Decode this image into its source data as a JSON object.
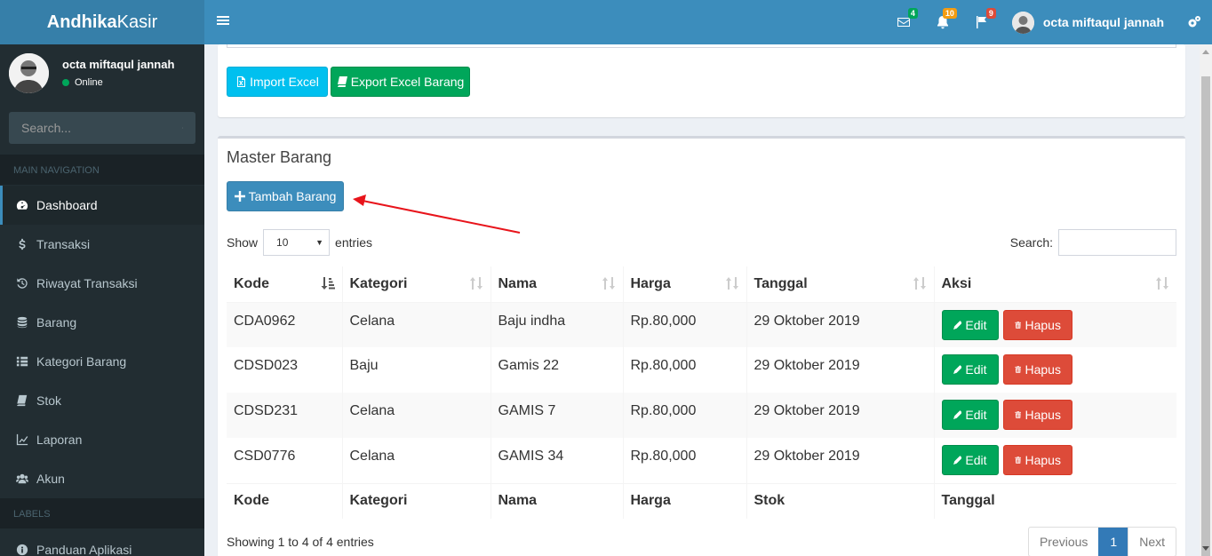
{
  "app": {
    "logo_bold": "Andhika",
    "logo_light": "Kasir"
  },
  "header": {
    "badges": {
      "mail": "4",
      "notifications": "10",
      "flags": "9"
    },
    "user_name": "octa miftaqul jannah"
  },
  "sidebar": {
    "user": {
      "name": "octa miftaqul jannah",
      "status": "Online"
    },
    "search_placeholder": "Search...",
    "nav_header": "MAIN NAVIGATION",
    "items": [
      {
        "label": "Dashboard",
        "icon": "dashboard-icon"
      },
      {
        "label": "Transaksi",
        "icon": "dollar-icon"
      },
      {
        "label": "Riwayat Transaksi",
        "icon": "history-icon"
      },
      {
        "label": "Barang",
        "icon": "database-icon"
      },
      {
        "label": "Kategori Barang",
        "icon": "list-icon"
      },
      {
        "label": "Stok",
        "icon": "book-icon"
      },
      {
        "label": "Laporan",
        "icon": "line-chart-icon"
      },
      {
        "label": "Akun",
        "icon": "users-icon"
      }
    ],
    "labels_header": "LABELS",
    "label_items": [
      {
        "label": "Panduan Aplikasi",
        "icon": "info-icon"
      }
    ]
  },
  "toolbar": {
    "import_label": "Import Excel",
    "export_label": "Export Excel Barang"
  },
  "master": {
    "title": "Master Barang",
    "add_label": "Tambah Barang",
    "show_label": "Show",
    "entries_label": "entries",
    "page_size": "10",
    "search_label": "Search:",
    "columns": [
      "Kode",
      "Kategori",
      "Nama",
      "Harga",
      "Tanggal",
      "Aksi"
    ],
    "footer_columns": [
      "Kode",
      "Kategori",
      "Nama",
      "Harga",
      "Stok",
      "Tanggal"
    ],
    "rows": [
      {
        "kode": "CDA0962",
        "kategori": "Celana",
        "nama": "Baju indha",
        "harga": "Rp.80,000",
        "tanggal": "29 Oktober 2019"
      },
      {
        "kode": "CDSD023",
        "kategori": "Baju",
        "nama": "Gamis 22",
        "harga": "Rp.80,000",
        "tanggal": "29 Oktober 2019"
      },
      {
        "kode": "CDSD231",
        "kategori": "Celana",
        "nama": "GAMIS 7",
        "harga": "Rp.80,000",
        "tanggal": "29 Oktober 2019"
      },
      {
        "kode": "CSD0776",
        "kategori": "Celana",
        "nama": "GAMIS 34",
        "harga": "Rp.80,000",
        "tanggal": "29 Oktober 2019"
      }
    ],
    "edit_label": "Edit",
    "delete_label": "Hapus",
    "info": "Showing 1 to 4 of 4 entries",
    "pager": {
      "previous": "Previous",
      "current": "1",
      "next": "Next"
    }
  },
  "colors": {
    "header": "#3c8dbc",
    "logo": "#367fa9",
    "sidebar": "#222d32",
    "success": "#00a65a",
    "danger": "#dd4b39",
    "info": "#00c0ef",
    "annotation_arrow": "#e8141b"
  }
}
